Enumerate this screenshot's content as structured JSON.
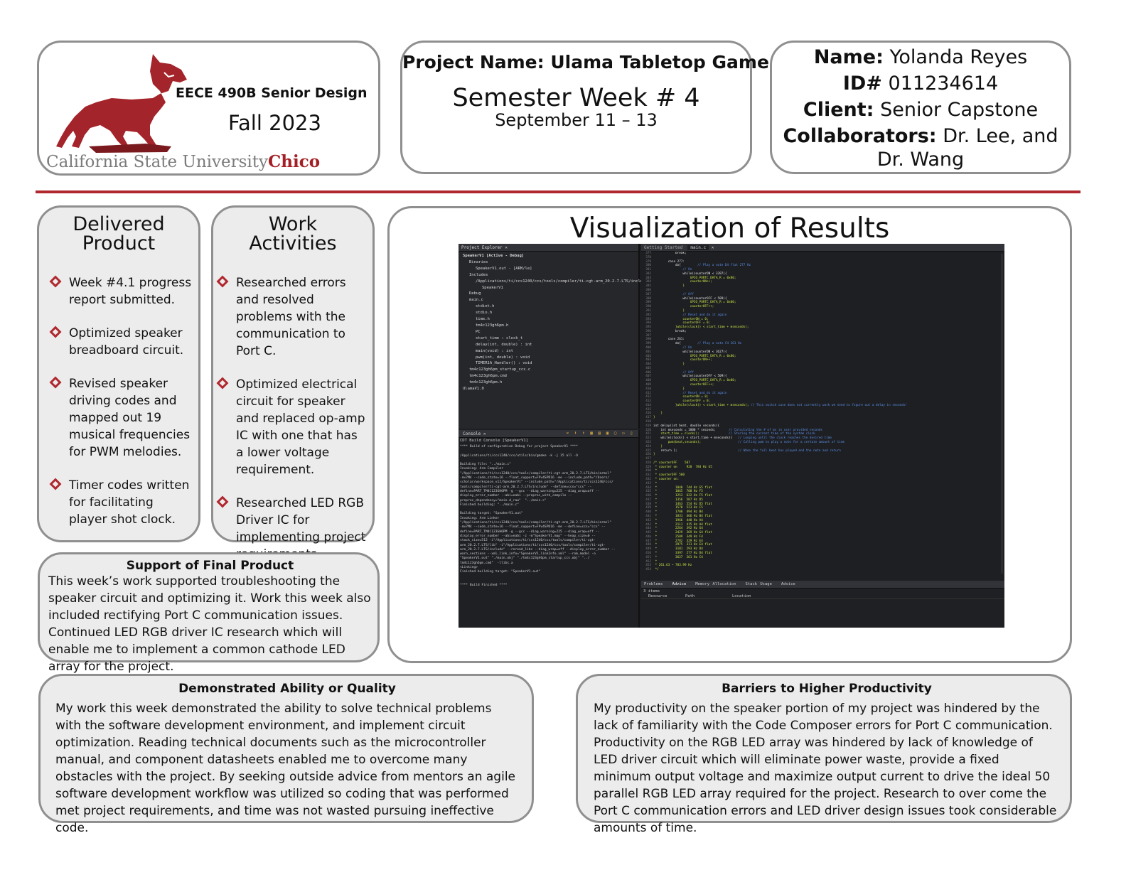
{
  "header": {
    "course": "EECE 490B Senior Design",
    "term": "Fall 2023",
    "university_prefix": "California State University",
    "university_suffix": "Chico",
    "project_name": "Project Name: Ulama Tabletop Game",
    "week": "Semester Week # 4",
    "dates": "September 11 – 13",
    "name_label": "Name:",
    "name_value": "Yolanda Reyes",
    "id_label": "ID#",
    "id_value": "011234614",
    "client_label": "Client:",
    "client_value": "Senior Capstone",
    "collab_label": "Collaborators:",
    "collab_value_1": "Dr. Lee, and",
    "collab_value_2": "Dr. Wang"
  },
  "delivered": {
    "title_1": "Delivered",
    "title_2": "Product",
    "items": [
      "Week #4.1 progress report submitted.",
      "Optimized speaker breadboard circuit.",
      "Revised speaker driving codes and mapped out 19 musical frequencies for PWM melodies.",
      "Timer codes written for facilitating player shot clock."
    ]
  },
  "work": {
    "title_1": "Work",
    "title_2": "Activities",
    "items": [
      "Researched errors and resolved problems with the communication to Port C.",
      "Optimized electrical circuit for speaker and replaced op-amp IC with one that has a lower voltage requirement.",
      "Researched LED RGB Driver IC for implementing project requirements properly."
    ]
  },
  "support": {
    "title": "Support of Final Product",
    "body": "This week’s work supported troubleshooting the speaker circuit and optimizing it. Work this week also included rectifying Port C communication issues. Continued LED RGB driver IC research which will enable me to implement a common cathode LED array for the project."
  },
  "visualization": {
    "title": "Visualization of Results",
    "ide": {
      "explorer_tab": "Project Explorer",
      "project": "SpeakerV1 [Active - Debug]",
      "tree": [
        "Binaries",
        "SpeakerV1.out - [ARM/le]",
        "Includes",
        "/Applications/ti/ccs1240/ccs/tools/compiler/ti-cgt-arm_20.2.7.LTS/include",
        "SpeakerV1",
        "Debug",
        "main.c",
        "stdint.h",
        "stdio.h",
        "time.h",
        "tm4c123gh6pm.h",
        "PC",
        "start_time : clock_t",
        "delay(int, double) : int",
        "main(void) : int",
        "pwm(int, double) : void",
        "TIMER1A_Handler() : void",
        "tm4c123gh6pm_startup_ccs.c",
        "tm4c123gh6pm.cmd",
        "tm4c123gh6pm.h",
        "UlamaV1.0"
      ],
      "editor_tabs": [
        "Getting Started",
        "main.c"
      ],
      "console_tab": "Console",
      "console_title": "CDT Build Console [SpeakerV1]",
      "console_lines": [
        "**** Build of configuration Debug for project SpeakerV1 ****",
        "",
        "/Applications/ti/ccs1240/ccs/utils/bin/gmake -k -j 15 all -O",
        "",
        "Building file: \"../main.c\"",
        "Invoking: Arm Compiler",
        "\"/Applications/ti/ccs1240/ccs/tools/compiler/ti-cgt-arm_20.2.7.LTS/bin/armcl\"",
        "-mv7M4 --code_state=16 --float_support=FPv4SPD16 -me --include_path=\"/Users/",
        "scholar/workspace_v12/SpeakerV1\" --include_path=\"/Applications/ti/ccs1240/ccs/",
        "tools/compiler/ti-cgt-arm_20.2.7.LTS/include\" --define=ccs=\"ccs\" --",
        "define=PART_TM4C123GH6PM -g --gcc --diag_warning=225 --diag_wrap=off --",
        "display_error_number --abi=eabi --preproc_with_compile --",
        "preproc_dependency=\"main.d_raw\"  \"../main.c\"",
        "Finished building: \"../main.c\"",
        "",
        "Building target: \"SpeakerV1.out\"",
        "Invoking: Arm Linker",
        "\"/Applications/ti/ccs1240/ccs/tools/compiler/ti-cgt-arm_20.2.7.LTS/bin/armcl\"",
        "-mv7M4 --code_state=16 --float_support=FPv4SPD16 -me --define=ccs=\"ccs\" --",
        "define=PART_TM4C123GH6PM -g --gcc --diag_warning=225 --diag_wrap=off --",
        "display_error_number --abi=eabi -z -m\"SpeakerV1.map\" --heap_size=0 --",
        "stack_size=512 -i\"/Applications/ti/ccs1240/ccs/tools/compiler/ti-cgt-",
        "arm_20.2.7.LTS/lib\" -i\"/Applications/ti/ccs1240/ccs/tools/compiler/ti-cgt-",
        "arm_20.2.7.LTS/include\" --reread_libs --diag_wrap=off --display_error_number --",
        "warn_sections --xml_link_info=\"SpeakerV1_linkInfo.xml\" --rom_model -o",
        "\"SpeakerV1.out\" \"./main.obj\" \"./tm4c123gh6pm_startup_ccs.obj\" \"../",
        "tm4c123gh6pm.cmd\"  -llibc.a",
        "<Linking>",
        "Finished building target: \"SpeakerV1.out\"",
        "",
        "",
        "**** Build Finished ****"
      ],
      "code_lines": [
        "            break;",
        "",
        "        case 277:",
        "            do{         // Play a note D4 flat 277 Hz",
        "                // On",
        "                while(counterON < 3397){",
        "                    GPIO_PORTC_DATA_R = 0x80;",
        "                    counterON++;",
        "                }",
        "",
        "                // Off",
        "                while(counterOFF < 509){",
        "                    GPIO_PORTC_DATA_R = 0x00;",
        "                    counterOFF++;",
        "                }",
        "                // Reset and do it again",
        "                counterON = 0;",
        "                counterOFF = 0;",
        "            }while(clock() < start_time + mseconds);",
        "            break;",
        "",
        "        case 261:",
        "            do{         // Play a note C4 261 Hz",
        "                // On",
        "                while(counterON < 3627){",
        "                    GPIO_PORTC_DATA_R = 0x80;",
        "                    counterON++;",
        "                }",
        "",
        "                // Off",
        "                while(counterOFF < 509){",
        "                    GPIO_PORTC_DATA_R = 0x00;",
        "                    counterOFF++;",
        "                }",
        "                // Reset and do it again",
        "                counterON = 0;",
        "                counterOFF = 0;",
        "            }while(clock() < start_time + mseconds); // This switch case does not currently work we need to figure out a delay in seconds!",
        "",
        "    }",
        "}",
        "",
        "int delay(int beat, double seconds){",
        "    int mseconds = 1000 * seconds;       // Calculating the # of ms in user provided seconds",
        "    start_time = clock();                // Storing the current time of the system clock",
        "    while(clock() < start_time + mseconds){   // Looping until the clock reaches the desired time",
        "        pwm(beat,seconds);                    // Calling pwm to play a note for a certain amount of time",
        "    }",
        "    return 1;                                 // When the full beat has played end the note and return",
        "}",
        "",
        "/* counterOFF    507",
        " * counter on     920  784 Hz G5",
        " *",
        " * counterOFF 500",
        " * counter on:",
        " *",
        " *          1040  744 Hz G5 flat",
        " *          1065  700 Hz F5",
        " *          1253  622 Hz F5 flat",
        " *          1356  587 Hz D5",
        " *          1463  554 Hz D5 flat",
        " *          1578  523 Hz C5",
        " *          1700  494 Hz B4",
        " *          1831  466 Hz B4 flat",
        " *          1966  440 Hz A4",
        " *          2111  415 Hz A4 flat",
        " *          2264  392 Hz G4",
        " *          2429  369 Hz G4 flat",
        " *          2509  349 Hz F4",
        " *          2782  329 Hz E4",
        " *          2975  311 Hz E4 flat",
        " *          3181  293 Hz D4",
        " *          3397  277 Hz D4 flat",
        " *          3627  261 Hz C4",
        " *",
        " * 261.63 ~ 783.99 Hz",
        " */"
      ],
      "line_start": 377,
      "bottom_tabs": [
        "Problems",
        "Advice",
        "Memory Allocation",
        "Stack Usage",
        "Advice"
      ],
      "bottom_count": "3 items",
      "bottom_columns": [
        "Resource",
        "Path",
        "Location"
      ]
    }
  },
  "demonstrated": {
    "title": "Demonstrated Ability or Quality",
    "body": "My work this week demonstrated the ability to solve technical problems with the software development environment, and implement circuit optimization. Reading technical documents such as the microcontroller manual, and component datasheets enabled me to overcome many obstacles with the project. By seeking outside advice from mentors an agile software development workflow was utilized so coding that was performed met project requirements, and time was not wasted pursuing ineffective code."
  },
  "barriers": {
    "title": "Barriers to Higher Productivity",
    "body": "My productivity on the speaker portion of my project was hindered by the lack of familiarity with the Code Composer errors for Port C communication. Productivity on the RGB LED array was hindered by lack of knowledge of LED driver circuit which will eliminate power waste, provide a fixed minimum output voltage and maximize output current to drive the ideal 50 parallel RGB LED array required for the project. Research to over come the Port C communication errors and LED driver design issues took considerable amounts of time."
  },
  "colors": {
    "accent": "#b0282e",
    "box_border": "#8f8f8f",
    "box_fill": "#ececec",
    "code_green": "#c8e64a",
    "code_comment": "#5a8ee8"
  }
}
